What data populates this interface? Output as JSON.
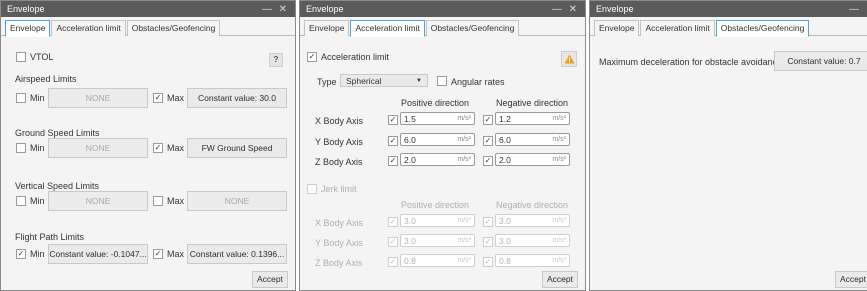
{
  "window_title": "Envelope",
  "tabs": [
    "Envelope",
    "Acceleration limit",
    "Obstacles/Geofencing"
  ],
  "accept_label": "Accept",
  "envelope": {
    "vtol_label": "VTOL",
    "help_label": "?",
    "airspeed": {
      "title": "Airspeed Limits",
      "min_label": "Min",
      "min_value": "NONE",
      "max_label": "Max",
      "max_value": "Constant value: 30.0"
    },
    "ground_speed": {
      "title": "Ground Speed Limits",
      "min_label": "Min",
      "min_value": "NONE",
      "max_label": "Max",
      "max_value": "FW Ground Speed"
    },
    "vertical_speed": {
      "title": "Vertical Speed Limits",
      "min_label": "Min",
      "min_value": "NONE",
      "max_label": "Max",
      "max_value": "NONE"
    },
    "flight_path": {
      "title": "Flight Path Limits",
      "min_label": "Min",
      "min_value": "Constant value: -0.1047...",
      "max_label": "Max",
      "max_value": "Constant value: 0.1396..."
    }
  },
  "accel": {
    "enable_label": "Acceleration limit",
    "type_label": "Type",
    "type_value": "Spherical",
    "angular_label": "Angular rates",
    "pos_dir": "Positive direction",
    "neg_dir": "Negative direction",
    "unit": "m/s²",
    "jerk_unit": "m/s³",
    "axes": [
      "X Body Axis",
      "Y Body Axis",
      "Z Body Axis"
    ],
    "pos_values": [
      "1.5",
      "6.0",
      "2.0"
    ],
    "neg_values": [
      "1.2",
      "6.0",
      "2.0"
    ],
    "jerk_label": "Jerk limit",
    "jerk_pos": [
      "3.0",
      "3.0",
      "0.8"
    ],
    "jerk_neg": [
      "3.0",
      "3.0",
      "0.8"
    ]
  },
  "obstacles": {
    "decel_label": "Maximum deceleration for obstacle avoidance",
    "decel_value": "Constant value: 0.7"
  },
  "icons": {
    "check": "check-icon",
    "warning": "warning-icon",
    "dropdown": "chevron-down-icon",
    "minimize": "minimize-icon",
    "close": "close-icon"
  },
  "colors": {
    "titlebar": "#5b5b5b",
    "active_tab": "#4ea3d9",
    "warning": "#f0a020"
  }
}
